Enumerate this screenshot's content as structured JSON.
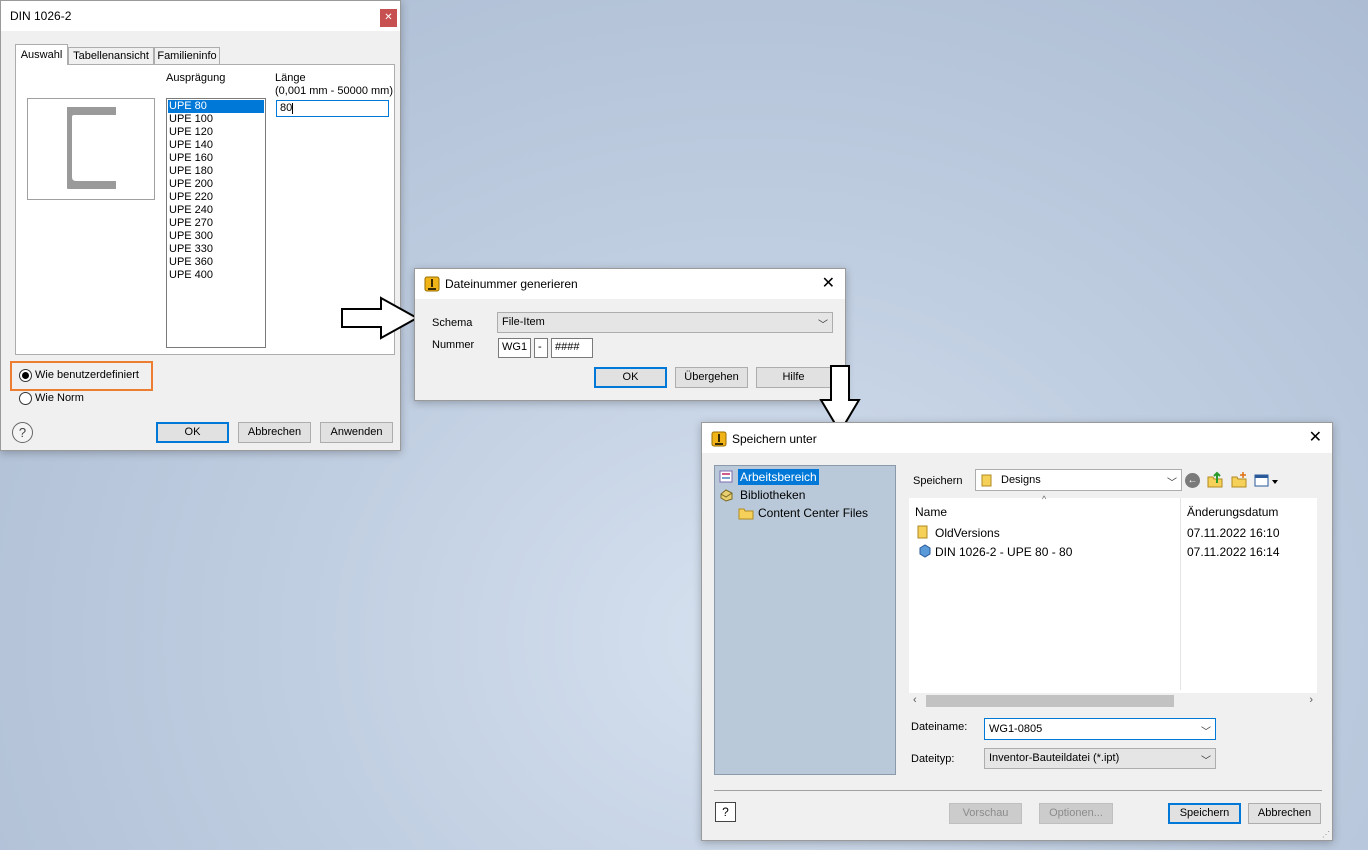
{
  "din_dialog": {
    "title": "DIN 1026-2",
    "tabs": [
      "Auswahl",
      "Tabellenansicht",
      "Familieninfo"
    ],
    "auspraegung_label": "Ausprägung",
    "laenge_label": "Länge",
    "laenge_range": "(0,001 mm - 50000 mm)",
    "laenge_value": "80",
    "sizes": [
      "UPE 80",
      "UPE 100",
      "UPE 120",
      "UPE 140",
      "UPE 160",
      "UPE 180",
      "UPE 200",
      "UPE 220",
      "UPE 240",
      "UPE 270",
      "UPE 300",
      "UPE 330",
      "UPE 360",
      "UPE 400"
    ],
    "selected_size": "UPE 80",
    "radio_custom": "Wie benutzerdefiniert",
    "radio_norm": "Wie Norm",
    "ok": "OK",
    "cancel": "Abbrechen",
    "apply": "Anwenden",
    "help_icon": "help-icon",
    "highlight_color": "#ed7d31"
  },
  "generate_dialog": {
    "title": "Dateinummer generieren",
    "schema_label": "Schema",
    "schema_value": "File-Item",
    "number_label": "Nummer",
    "number_parts": [
      "WG1",
      "-",
      "####"
    ],
    "ok": "OK",
    "skip": "Übergehen",
    "help": "Hilfe"
  },
  "save_dialog": {
    "title": "Speichern unter",
    "tree": {
      "workspace": "Arbeitsbereich",
      "libraries": "Bibliotheken",
      "content_center": "Content Center Files"
    },
    "save_in_label": "Speichern",
    "save_in_value": "Designs",
    "columns": [
      "Name",
      "Änderungsdatum"
    ],
    "files": [
      {
        "name": "OldVersions",
        "date": "07.11.2022 16:10",
        "icon": "folder-icon"
      },
      {
        "name": "DIN 1026-2 - UPE 80 - 80",
        "date": "07.11.2022 16:14",
        "icon": "part-icon"
      }
    ],
    "filename_label": "Dateiname:",
    "filename_value": "WG1-0805",
    "filetype_label": "Dateityp:",
    "filetype_value": "Inventor-Bauteildatei (*.ipt)",
    "preview": "Vorschau",
    "options": "Optionen...",
    "save": "Speichern",
    "cancel": "Abbrechen"
  },
  "colors": {
    "selection": "#0078d7",
    "tree_panel": "#b9c9d9"
  }
}
